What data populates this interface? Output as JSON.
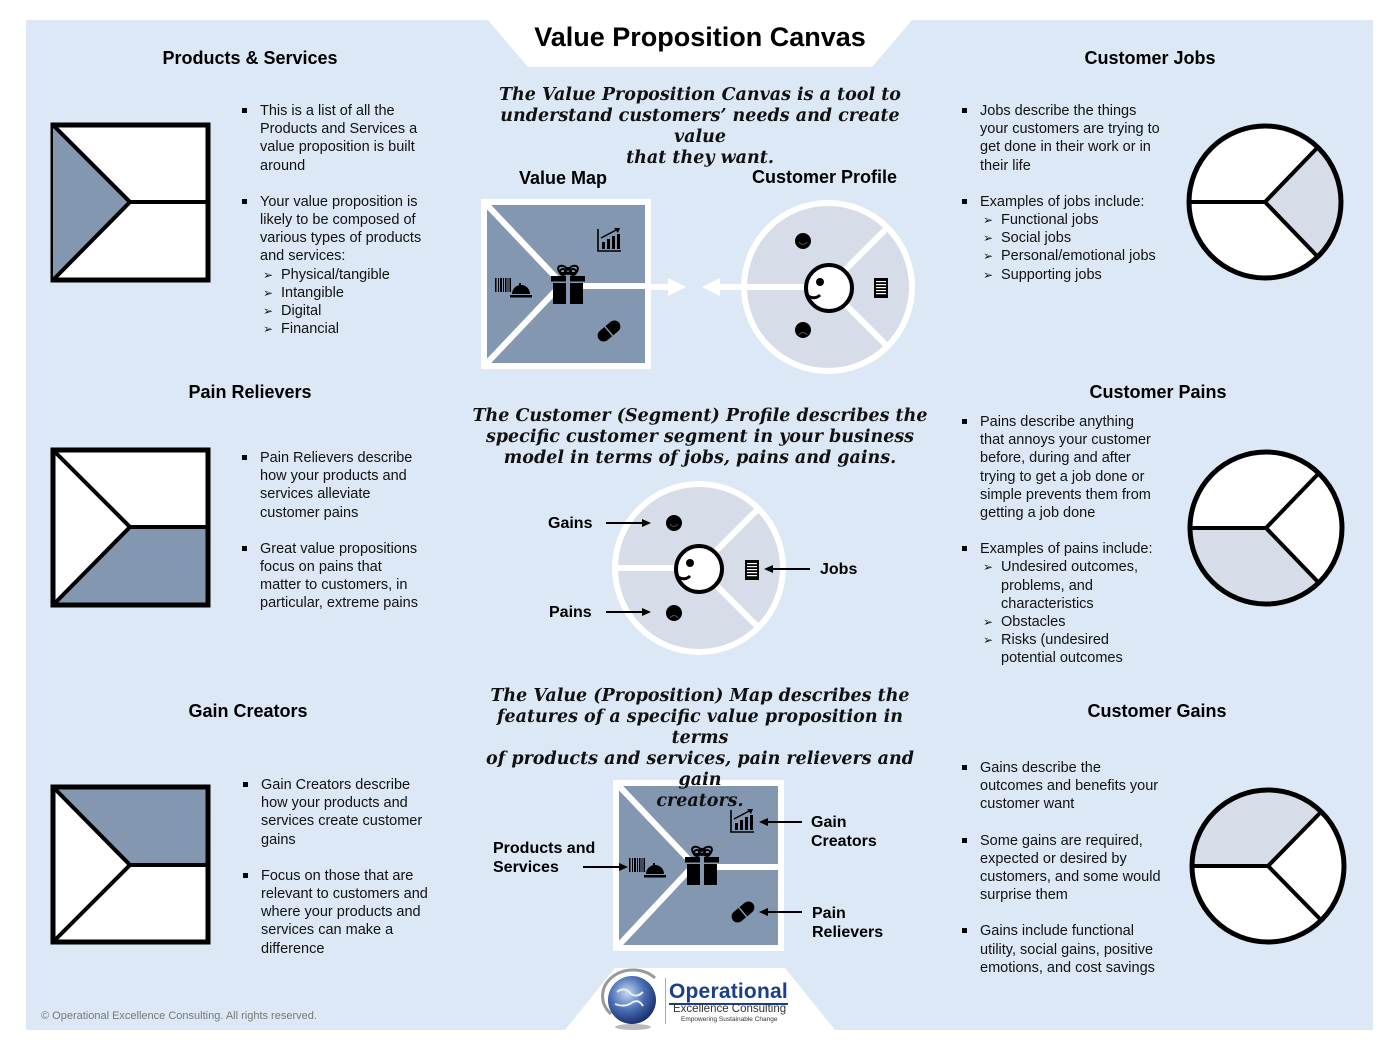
{
  "header": {
    "title": "Value Proposition Canvas"
  },
  "intro": {
    "lines": [
      "The Value Proposition Canvas is a tool to",
      "understand customers’ needs and create value",
      "that they want."
    ]
  },
  "overview": {
    "value_map_label": "Value Map",
    "customer_profile_label": "Customer Profile"
  },
  "left": {
    "products_services": {
      "title": "Products & Services",
      "bullets": [
        {
          "text": [
            "This is a list of all the",
            "Products and Services a",
            "value proposition is built",
            "around"
          ]
        },
        {
          "text": [
            "Your value proposition is",
            "likely to be composed of",
            "various types of products",
            "and services:"
          ],
          "sub": [
            "Physical/tangible",
            "Intangible",
            "Digital",
            "Financial"
          ]
        }
      ]
    },
    "pain_relievers": {
      "title": "Pain Relievers",
      "bullets": [
        {
          "text": [
            "Pain Relievers describe",
            "how your products and",
            "services alleviate",
            "customer pains"
          ]
        },
        {
          "text": [
            "Great value propositions",
            "focus on pains that",
            "matter to customers, in",
            "particular, extreme pains"
          ]
        }
      ]
    },
    "gain_creators": {
      "title": "Gain Creators",
      "bullets": [
        {
          "text": [
            "Gain Creators describe",
            "how your products and",
            "services create customer",
            "gains"
          ]
        },
        {
          "text": [
            "Focus on those that are",
            "relevant to customers and",
            "where your products and",
            "services can make a",
            "difference"
          ]
        }
      ]
    }
  },
  "right": {
    "customer_jobs": {
      "title": "Customer Jobs",
      "bullets": [
        {
          "text": [
            "Jobs describe the things",
            "your customers are trying to",
            "get done in their work or in",
            "their life"
          ]
        },
        {
          "text": [
            "Examples of jobs include:"
          ],
          "sub": [
            "Functional jobs",
            "Social jobs",
            "Personal/emotional jobs",
            "Supporting jobs"
          ]
        }
      ]
    },
    "customer_pains": {
      "title": "Customer Pains",
      "bullets": [
        {
          "text": [
            "Pains describe anything",
            "that annoys your customer",
            "before, during and after",
            "trying to get a job done or",
            "simple prevents them from",
            "getting a job done"
          ]
        },
        {
          "text": [
            "Examples of pains include:"
          ],
          "sub": [
            "Undesired outcomes,|problems, and|characteristics",
            "Obstacles",
            "Risks (undesired|potential outcomes"
          ]
        }
      ]
    },
    "customer_gains": {
      "title": "Customer Gains",
      "bullets": [
        {
          "text": [
            "Gains describe the",
            "outcomes and benefits your",
            "customer want"
          ]
        },
        {
          "text": [
            "Some gains are required,",
            "expected or desired by",
            "customers, and some would",
            "surprise them"
          ]
        },
        {
          "text": [
            "Gains include functional",
            "utility, social gains, positive",
            "emotions, and cost savings"
          ]
        }
      ]
    }
  },
  "profile_section": {
    "description": [
      "The Customer (Segment) Profile describes the",
      "specific customer segment in your business",
      "model in terms of jobs, pains and gains."
    ],
    "labels": {
      "gains": "Gains",
      "pains": "Pains",
      "jobs": "Jobs"
    }
  },
  "map_section": {
    "description": [
      "The Value (Proposition) Map describes the",
      "features of a specific value proposition in terms",
      "of products and services, pain relievers and gain",
      "creators."
    ],
    "labels": {
      "products_services": "Products and|Services",
      "gain_creators": "Gain|Creators",
      "pain_relievers": "Pain|Relievers"
    }
  },
  "colors": {
    "background": "#dce8f5",
    "map_fill": "#8497b0",
    "profile_fill": "#d6dde8",
    "white": "#ffffff",
    "ink": "#000000"
  },
  "footer": {
    "copyright": "© Operational Excellence Consulting. All rights reserved.",
    "logo_main": "Operational",
    "logo_sub": "Excellence Consulting",
    "logo_tag": "Empowering Sustainable Change"
  }
}
